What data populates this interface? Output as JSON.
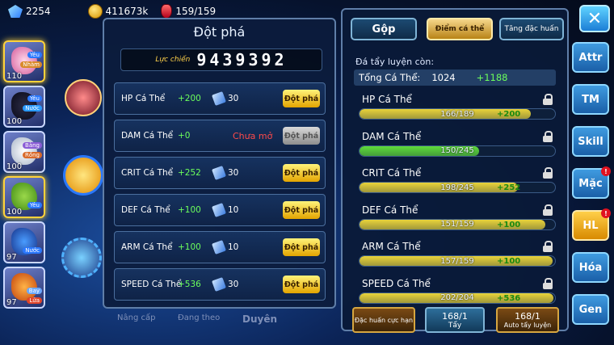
{
  "currency": {
    "gems": "2254",
    "gold": "411673k",
    "stamina": "159/159"
  },
  "team": [
    {
      "level": "110",
      "type": "Yêu",
      "type2": "Nhàm"
    },
    {
      "level": "100",
      "type": "Yêu",
      "type2": "Nước"
    },
    {
      "level": "100",
      "type": "Bàng",
      "type2": "Rồng"
    },
    {
      "level": "100",
      "type": "Yêu",
      "type2": ""
    },
    {
      "level": "97",
      "type": "Nước",
      "type2": ""
    },
    {
      "level": "97",
      "type": "Bay",
      "type2": "Lửa"
    }
  ],
  "bottom_nav": [
    "Nâng cấp",
    "Đang theo",
    "Duyên"
  ],
  "breakthrough": {
    "title": "Đột phá",
    "power_label": "Lực chiến",
    "power_value": "9439392",
    "rows": [
      {
        "name": "HP Cá Thể",
        "value": "+200",
        "cost": "30",
        "button": "Đột phá",
        "locked": false
      },
      {
        "name": "DAM Cá Thể",
        "value": "+0",
        "cost": "",
        "button": "Đột phá",
        "locked": true,
        "lock_text": "Chưa mở"
      },
      {
        "name": "CRIT Cá Thể",
        "value": "+252",
        "cost": "30",
        "button": "Đột phá",
        "locked": false
      },
      {
        "name": "DEF Cá Thể",
        "value": "+100",
        "cost": "10",
        "button": "Đột phá",
        "locked": false
      },
      {
        "name": "ARM Cá Thể",
        "value": "+100",
        "cost": "10",
        "button": "Đột phá",
        "locked": false
      },
      {
        "name": "SPEED Cá Thể",
        "value": "+536",
        "cost": "30",
        "button": "Đột phá",
        "locked": false
      }
    ]
  },
  "training": {
    "tabs": [
      "Gộp",
      "Điểm cá thể",
      "Tăng đặc huấn"
    ],
    "remaining_label": "Đá tẩy luyện còn:",
    "total_label": "Tổng Cá Thể:",
    "total_value": "1024",
    "total_bonus": "+1188",
    "stats": [
      {
        "name": "HP Cá Thể",
        "bar_text": "166/189",
        "bonus": "+200",
        "fill": 0.878,
        "color": "#e9d43a"
      },
      {
        "name": "DAM Cá Thể",
        "bar_text": "150/245",
        "bonus": "",
        "fill": 0.612,
        "color": "#5fdc3a"
      },
      {
        "name": "CRIT Cá Thể",
        "bar_text": "198/245",
        "bonus": "+252",
        "fill": 0.808,
        "color": "#e9d43a"
      },
      {
        "name": "DEF Cá Thể",
        "bar_text": "151/159",
        "bonus": "+100",
        "fill": 0.95,
        "color": "#e9d43a"
      },
      {
        "name": "ARM Cá Thể",
        "bar_text": "157/159",
        "bonus": "+100",
        "fill": 0.987,
        "color": "#e9d43a"
      },
      {
        "name": "SPEED Cá Thể",
        "bar_text": "202/204",
        "bonus": "+536",
        "fill": 0.99,
        "color": "#e9d43a"
      }
    ],
    "buttons": [
      {
        "label": "Đặc huấn cực hạn",
        "sub": ""
      },
      {
        "label": "168/1",
        "sub": "Tẩy"
      },
      {
        "label": "168/1",
        "sub": "Auto tẩy luyện"
      }
    ]
  },
  "side_menu": [
    {
      "label": "Attr",
      "badge": false
    },
    {
      "label": "TM",
      "badge": false
    },
    {
      "label": "Skill",
      "badge": false
    },
    {
      "label": "Mặc",
      "badge": true
    },
    {
      "label": "HL",
      "badge": true
    },
    {
      "label": "Hóa",
      "badge": false
    },
    {
      "label": "Gen",
      "badge": false
    }
  ]
}
